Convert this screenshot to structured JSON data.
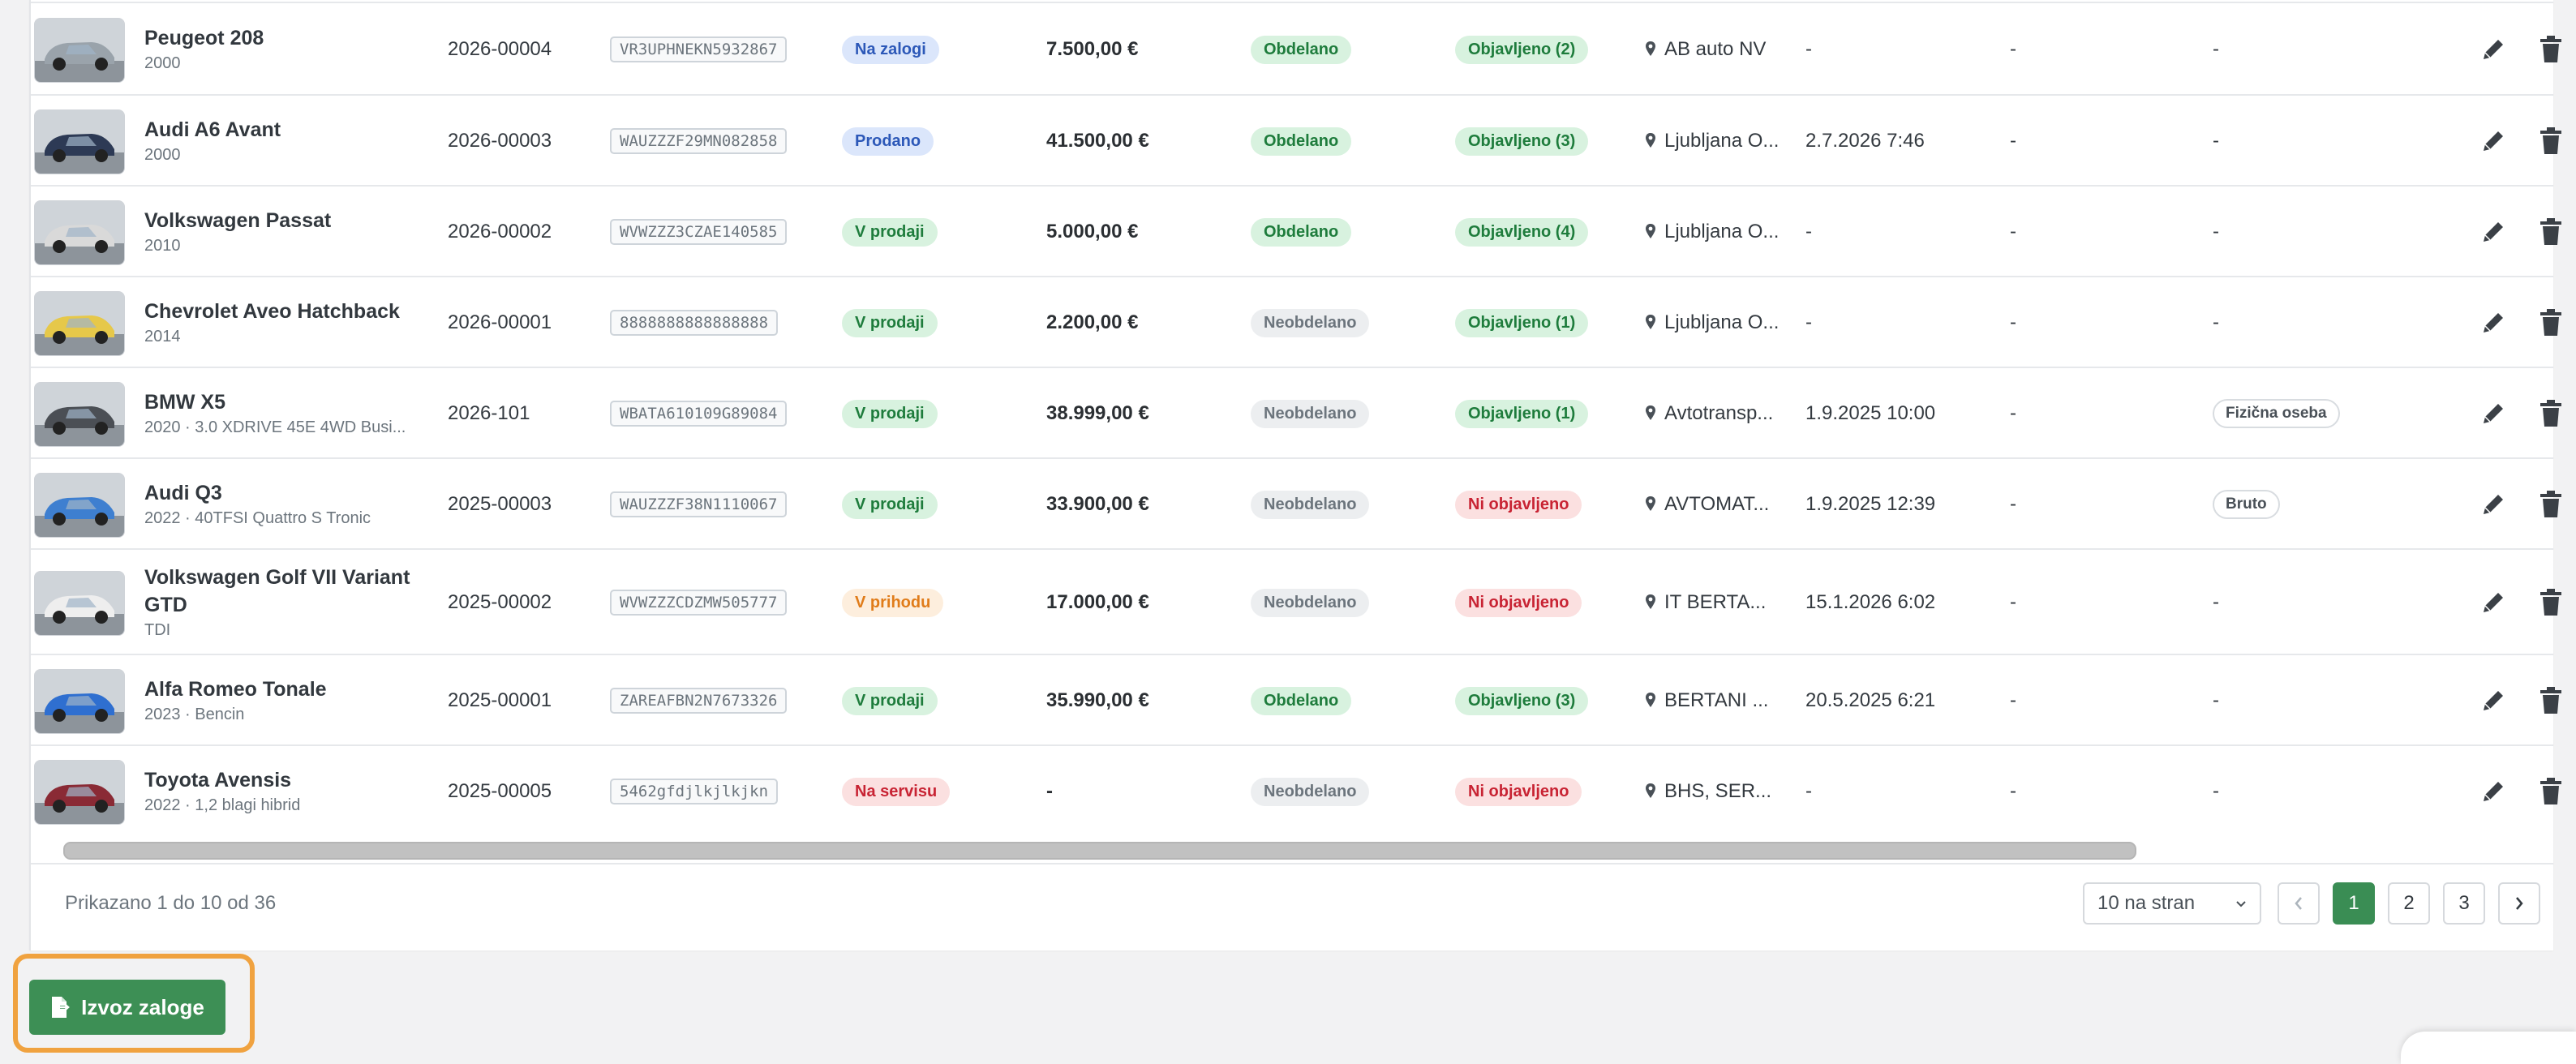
{
  "rows": [
    {
      "name": "Peugeot 208",
      "sub": "2000",
      "code": "2026-00004",
      "vin": "VR3UPHNEKN5932867",
      "status": {
        "label": "Na zalogi",
        "tone": "blue"
      },
      "price": "7.500,00 €",
      "processed": {
        "label": "Obdelano",
        "tone": "green"
      },
      "published": {
        "label": "Objavljeno (2)",
        "tone": "green"
      },
      "location": "AB auto NV",
      "date": "-",
      "col2": "-",
      "col3": "-",
      "tag": "",
      "photo": "#9aa3ab"
    },
    {
      "name": "Audi A6 Avant",
      "sub": "2000",
      "code": "2026-00003",
      "vin": "WAUZZZF29MN082858",
      "status": {
        "label": "Prodano",
        "tone": "blue"
      },
      "price": "41.500,00 €",
      "processed": {
        "label": "Obdelano",
        "tone": "green"
      },
      "published": {
        "label": "Objavljeno (3)",
        "tone": "green"
      },
      "location": "Ljubljana O...",
      "date": "2.7.2026 7:46",
      "col2": "-",
      "col3": "-",
      "tag": "",
      "photo": "#2d3a55"
    },
    {
      "name": "Volkswagen Passat",
      "sub": "2010",
      "code": "2026-00002",
      "vin": "WVWZZZ3CZAE140585",
      "status": {
        "label": "V prodaji",
        "tone": "green"
      },
      "price": "5.000,00 €",
      "processed": {
        "label": "Obdelano",
        "tone": "green"
      },
      "published": {
        "label": "Objavljeno (4)",
        "tone": "green"
      },
      "location": "Ljubljana O...",
      "date": "-",
      "col2": "-",
      "col3": "-",
      "tag": "",
      "photo": "#d9d9d9"
    },
    {
      "name": "Chevrolet Aveo Hatchback",
      "sub": "2014",
      "code": "2026-00001",
      "vin": "8888888888888888",
      "status": {
        "label": "V prodaji",
        "tone": "green"
      },
      "price": "2.200,00 €",
      "processed": {
        "label": "Neobdelano",
        "tone": "gray"
      },
      "published": {
        "label": "Objavljeno (1)",
        "tone": "green"
      },
      "location": "Ljubljana O...",
      "date": "-",
      "col2": "-",
      "col3": "-",
      "tag": "",
      "photo": "#e6c84a"
    },
    {
      "name": "BMW X5",
      "sub": "2020 · 3.0 XDRIVE 45E 4WD Busi...",
      "code": "2026-101",
      "vin": "WBATA610109G89084",
      "status": {
        "label": "V prodaji",
        "tone": "green"
      },
      "price": "38.999,00 €",
      "processed": {
        "label": "Neobdelano",
        "tone": "gray"
      },
      "published": {
        "label": "Objavljeno (1)",
        "tone": "green"
      },
      "location": "Avtotransp...",
      "date": "1.9.2025 10:00",
      "col2": "-",
      "col3": "",
      "tag": "Fizična oseba",
      "photo": "#4b4f55"
    },
    {
      "name": "Audi Q3",
      "sub": "2022 · 40TFSI Quattro S Tronic",
      "code": "2025-00003",
      "vin": "WAUZZZF38N1110067",
      "status": {
        "label": "V prodaji",
        "tone": "green"
      },
      "price": "33.900,00 €",
      "processed": {
        "label": "Neobdelano",
        "tone": "gray"
      },
      "published": {
        "label": "Ni objavljeno",
        "tone": "red"
      },
      "location": "AVTOMAT...",
      "date": "1.9.2025 12:39",
      "col2": "-",
      "col3": "",
      "tag": "Bruto",
      "photo": "#3e7fd0"
    },
    {
      "name": "Volkswagen Golf VII Variant GTD",
      "sub": "TDI",
      "code": "2025-00002",
      "vin": "WVWZZZCDZMW505777",
      "status": {
        "label": "V prihodu",
        "tone": "orange"
      },
      "price": "17.000,00 €",
      "processed": {
        "label": "Neobdelano",
        "tone": "gray"
      },
      "published": {
        "label": "Ni objavljeno",
        "tone": "red"
      },
      "location": "IT BERTA...",
      "date": "15.1.2026 6:02",
      "col2": "-",
      "col3": "-",
      "tag": "",
      "photo": "#eeeeee"
    },
    {
      "name": "Alfa Romeo Tonale",
      "sub": "2023 · Bencin",
      "code": "2025-00001",
      "vin": "ZAREAFBN2N7673326",
      "status": {
        "label": "V prodaji",
        "tone": "green"
      },
      "price": "35.990,00 €",
      "processed": {
        "label": "Obdelano",
        "tone": "green"
      },
      "published": {
        "label": "Objavljeno (3)",
        "tone": "green"
      },
      "location": "BERTANI ...",
      "date": "20.5.2025 6:21",
      "col2": "-",
      "col3": "-",
      "tag": "",
      "photo": "#2f6fd0"
    },
    {
      "name": "Toyota Avensis",
      "sub": "2022 · 1,2 blagi hibrid",
      "code": "2025-00005",
      "vin": "5462gfdjlkjlkjkn",
      "status": {
        "label": "Na servisu",
        "tone": "red"
      },
      "price": "-",
      "processed": {
        "label": "Neobdelano",
        "tone": "gray"
      },
      "published": {
        "label": "Ni objavljeno",
        "tone": "red"
      },
      "location": "BHS, SER...",
      "date": "-",
      "col2": "-",
      "col3": "-",
      "tag": "",
      "photo": "#8a2a35"
    }
  ],
  "footer": {
    "summary": "Prikazano 1 do 10 od 36",
    "per_page": "10 na stran",
    "pages": [
      "1",
      "2",
      "3"
    ],
    "active_page": "1"
  },
  "export": {
    "label": "Izvoz zaloge"
  },
  "colors": {
    "accent": "#3d8f55",
    "highlight": "#f0a23f"
  },
  "icons": {
    "edit": "pencil-icon",
    "delete": "trash-icon",
    "location": "map-pin-icon",
    "export": "file-export-icon"
  }
}
